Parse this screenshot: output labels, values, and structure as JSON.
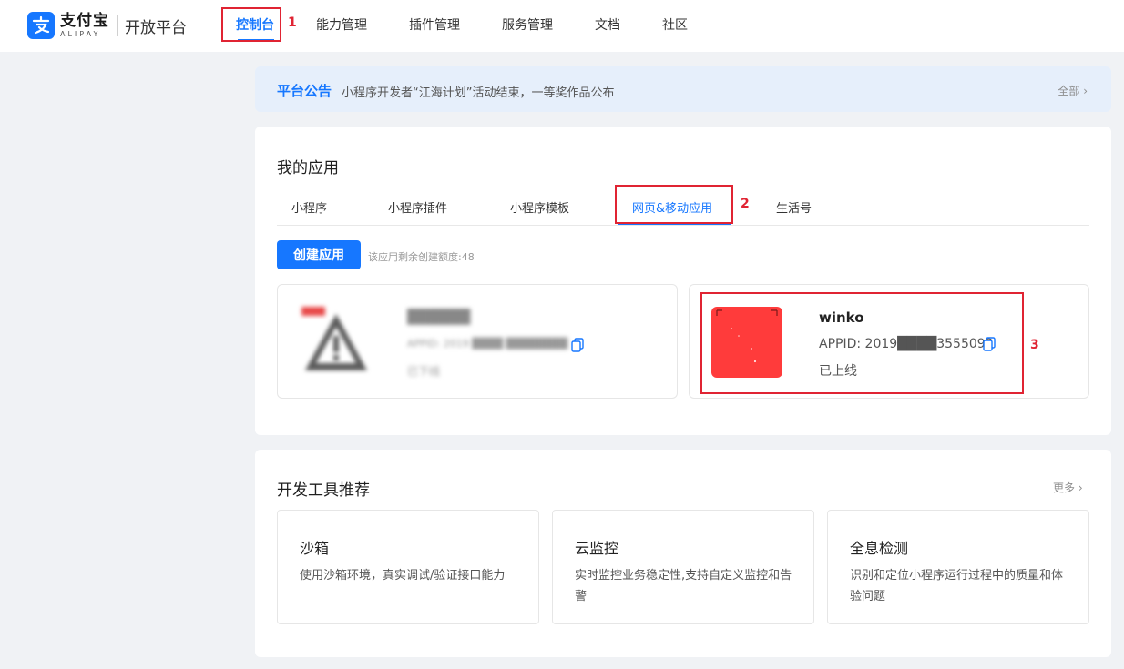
{
  "header": {
    "logo_cn": "支付宝",
    "logo_en": "ALIPAY",
    "logo_sub": "开放平台",
    "nav": [
      {
        "label": "控制台",
        "active": true
      },
      {
        "label": "能力管理"
      },
      {
        "label": "插件管理"
      },
      {
        "label": "服务管理"
      },
      {
        "label": "文档"
      },
      {
        "label": "社区"
      }
    ]
  },
  "annotations": {
    "one": "1",
    "two": "2",
    "three": "3"
  },
  "notice": {
    "title": "平台公告",
    "text": "小程序开发者“江海计划”活动结束，一等奖作品公布",
    "all": "全部 ›"
  },
  "my_apps": {
    "title": "我的应用",
    "tabs": [
      "小程序",
      "小程序插件",
      "小程序模板",
      "网页&移动应用",
      "生活号"
    ],
    "active_tab": "网页&移动应用",
    "create_button": "创建应用",
    "quota_text": "该应用剩余创建额度:48",
    "apps": [
      {
        "name": "██████",
        "appid": "APPID: 2019 ████ ████████",
        "status": "已下线"
      },
      {
        "name": "winko",
        "appid": "APPID: 2019████3555092",
        "status": "已上线"
      }
    ]
  },
  "tools": {
    "title": "开发工具推荐",
    "more": "更多 ›",
    "items": [
      {
        "name": "沙箱",
        "desc": "使用沙箱环境，真实调试/验证接口能力"
      },
      {
        "name": "云监控",
        "desc": "实时监控业务稳定性,支持自定义监控和告警"
      },
      {
        "name": "全息检测",
        "desc": "识别和定位小程序运行过程中的质量和体验问题"
      }
    ]
  },
  "colors": {
    "accent": "#1677ff",
    "annotation": "#e02433",
    "app_icon": "#ff3b3b"
  }
}
